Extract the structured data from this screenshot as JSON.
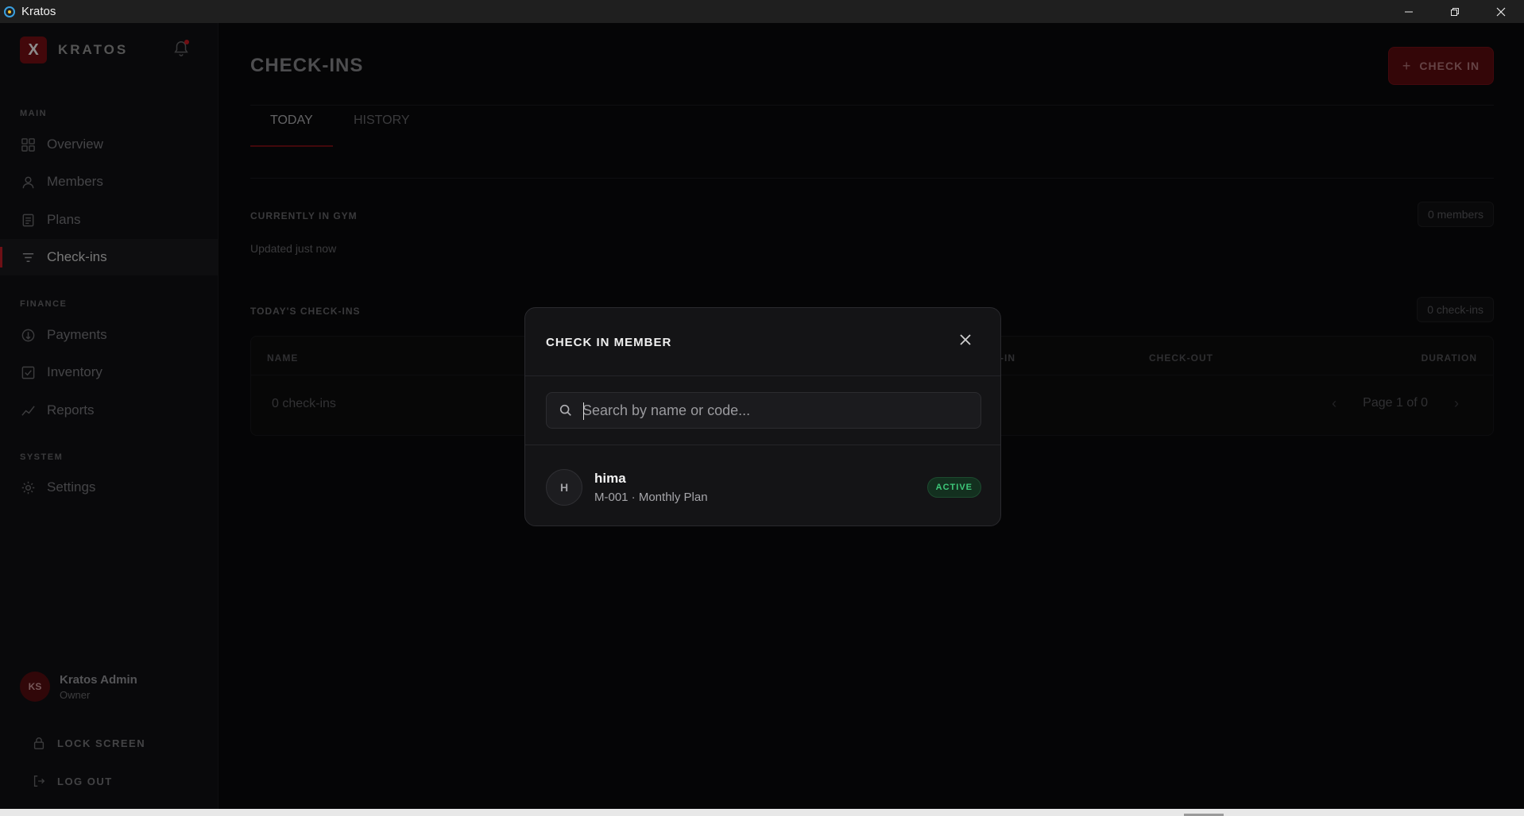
{
  "window": {
    "title": "Kratos"
  },
  "brand": {
    "logo_letter": "X",
    "name": "KRATOS"
  },
  "sidebar": {
    "sections": {
      "main": "MAIN",
      "finance": "FINANCE",
      "system": "SYSTEM"
    },
    "items": [
      {
        "label": "Overview",
        "icon": "grid-icon"
      },
      {
        "label": "Members",
        "icon": "user-icon"
      },
      {
        "label": "Plans",
        "icon": "document-icon"
      },
      {
        "label": "Check-ins",
        "icon": "filter-lines-icon",
        "active": true
      },
      {
        "label": "Payments",
        "icon": "coin-icon"
      },
      {
        "label": "Inventory",
        "icon": "checkbox-icon"
      },
      {
        "label": "Reports",
        "icon": "trend-line-icon"
      },
      {
        "label": "Settings",
        "icon": "gear-icon"
      }
    ],
    "user": {
      "initials": "KS",
      "name": "Kratos Admin",
      "role": "Owner"
    },
    "lock_label": "LOCK SCREEN",
    "logout_label": "LOG OUT"
  },
  "main": {
    "title": "CHECK-INS",
    "checkin_button": "CHECK IN",
    "tabs": [
      {
        "label": "TODAY",
        "active": true
      },
      {
        "label": "HISTORY",
        "active": false
      }
    ],
    "currently_in_gym": {
      "label": "CURRENTLY IN GYM",
      "updated": "Updated just now",
      "count": "0 members"
    },
    "todays_checkins": {
      "label": "TODAY'S CHECK-INS",
      "count": "0 check-ins",
      "columns": [
        "NAME",
        "-IN",
        "CHECK-OUT",
        "DURATION"
      ],
      "footer_count": "0 check-ins",
      "pagination": "Page 1 of 0"
    }
  },
  "modal": {
    "title": "CHECK IN MEMBER",
    "search_placeholder": "Search by name or code...",
    "search_value": "",
    "results": [
      {
        "initial": "H",
        "name": "hima",
        "meta": "M-001 · Monthly Plan",
        "status": "ACTIVE"
      }
    ]
  },
  "colors": {
    "accent": "#c81e28",
    "status_active": "#3ec97a"
  }
}
